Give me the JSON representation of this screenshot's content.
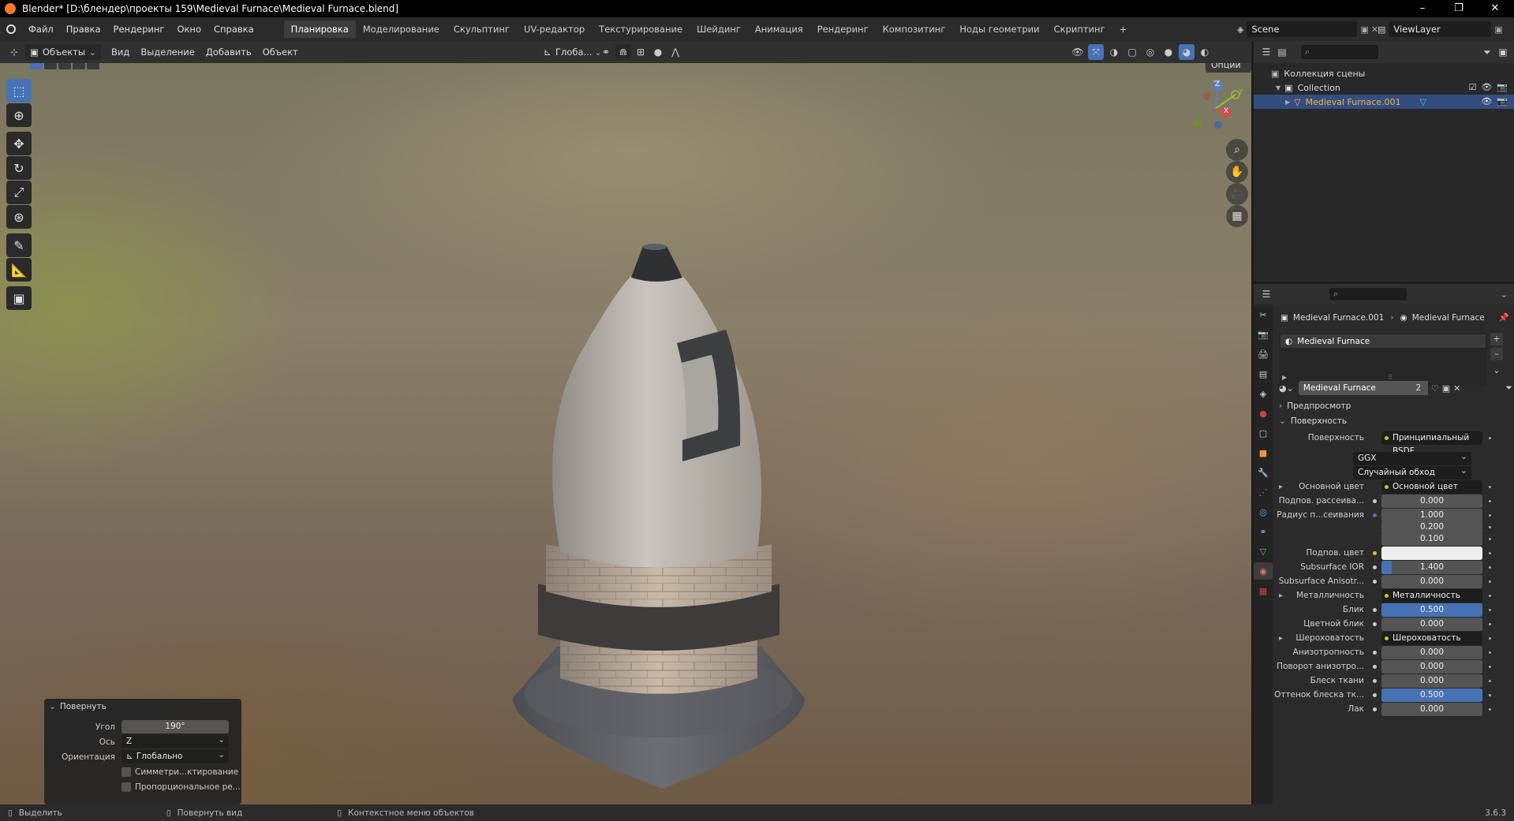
{
  "window": {
    "title": "Blender* [D:\\блендер\\проекты 159\\Medieval Furnace\\Medieval Furnace.blend]",
    "minimize": "–",
    "maximize": "❐",
    "close": "✕"
  },
  "menu": [
    "Файл",
    "Правка",
    "Рендеринг",
    "Окно",
    "Справка"
  ],
  "workspaces": [
    "Планировка",
    "Моделирование",
    "Скульптинг",
    "UV-редактор",
    "Текстурирование",
    "Шейдинг",
    "Анимация",
    "Рендеринг",
    "Композитинг",
    "Ноды геометрии",
    "Скриптинг"
  ],
  "workspace_add": "+",
  "active_workspace": "Планировка",
  "scene": {
    "name": "Scene",
    "view_layer": "ViewLayer"
  },
  "viewport_header": {
    "mode": "Объекты",
    "menus": [
      "Вид",
      "Выделение",
      "Добавить",
      "Объект"
    ],
    "orientation": "Глоба...",
    "options": "Опции"
  },
  "tools": [
    "select-box",
    "cursor",
    "move",
    "rotate",
    "scale",
    "transform",
    "annotate",
    "measure",
    "add-cube"
  ],
  "operator_panel": {
    "title": "Повернуть",
    "angle_label": "Угол",
    "angle_value": "190°",
    "axis_label": "Ось",
    "axis_value": "Z",
    "orient_label": "Ориентация",
    "orient_value": "Глобально",
    "symmetry_label": "Симметри...ктирование",
    "proportional_label": "Пропорциональное ре..."
  },
  "statusbar": {
    "select": "Выделить",
    "rotate_view": "Повернуть вид",
    "context_menu": "Контекстное меню объектов",
    "version": "3.6.3"
  },
  "gizmo": {
    "z": "Z",
    "y": "Y",
    "x": "X"
  },
  "outliner": {
    "scene_collection": "Коллекция сцены",
    "collection": "Collection",
    "object": "Medieval Furnace.001"
  },
  "properties": {
    "breadcrumb_object": "Medieval Furnace.001",
    "breadcrumb_material": "Medieval Furnace",
    "slot_name": "Medieval Furnace",
    "material_name": "Medieval Furnace",
    "users": "2",
    "preview_label": "Предпросмотр",
    "surface_panel": "Поверхность",
    "rows": [
      {
        "label": "Поверхность",
        "type": "link",
        "value": "Принципиальный BSDF"
      },
      {
        "label": "",
        "type": "select",
        "value": "GGX"
      },
      {
        "label": "",
        "type": "select",
        "value": "Случайный обход"
      },
      {
        "label": "Основной цвет",
        "type": "link",
        "value": "Основной цвет",
        "expand": true
      },
      {
        "label": "Подпов. рассеива...",
        "type": "num",
        "value": "0.000",
        "fill": 0,
        "dot": "grey"
      },
      {
        "label": "Радиус п...сеивания",
        "type": "num",
        "value": "1.000",
        "fill": 0,
        "dot": "blue"
      },
      {
        "label": "",
        "type": "num",
        "value": "0.200",
        "fill": 0
      },
      {
        "label": "",
        "type": "num",
        "value": "0.100",
        "fill": 0
      },
      {
        "label": "Подпов. цвет",
        "type": "color",
        "value": "#ededed",
        "dot": "yellow"
      },
      {
        "label": "Subsurface IOR",
        "type": "num",
        "value": "1.400",
        "fill": 0.1,
        "dot": "grey"
      },
      {
        "label": "Subsurface Anisotr...",
        "type": "num",
        "value": "0.000",
        "fill": 0,
        "dot": "grey"
      },
      {
        "label": "Металличность",
        "type": "link",
        "value": "Металличность",
        "expand": true
      },
      {
        "label": "Блик",
        "type": "num",
        "value": "0.500",
        "fill": 1,
        "dot": "grey"
      },
      {
        "label": "Цветной блик",
        "type": "num",
        "value": "0.000",
        "fill": 0,
        "dot": "grey"
      },
      {
        "label": "Шероховатость",
        "type": "link",
        "value": "Шероховатость",
        "expand": true
      },
      {
        "label": "Анизотропность",
        "type": "num",
        "value": "0.000",
        "fill": 0,
        "dot": "grey"
      },
      {
        "label": "Поворот анизотро...",
        "type": "num",
        "value": "0.000",
        "fill": 0,
        "dot": "grey"
      },
      {
        "label": "Блеск ткани",
        "type": "num",
        "value": "0.000",
        "fill": 0,
        "dot": "grey"
      },
      {
        "label": "Оттенок блеска тк...",
        "type": "num",
        "value": "0.500",
        "fill": 1,
        "dot": "grey"
      },
      {
        "label": "Лак",
        "type": "num",
        "value": "0.000",
        "fill": 0,
        "dot": "grey"
      }
    ]
  },
  "colors": {
    "accent": "#4772b3",
    "selection": "#334d80",
    "active_object": "#f5b342",
    "socket_yellow": "#c7c729"
  }
}
